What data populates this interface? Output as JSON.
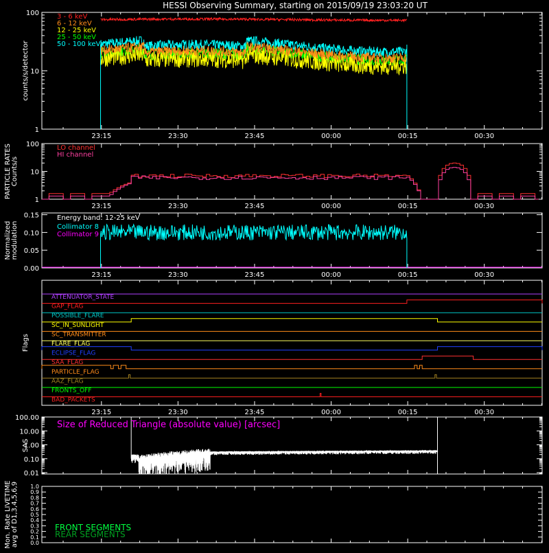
{
  "title": "HESSI Observing Summary, starting on 2015/09/19 23:03:20 UT",
  "time_axis": {
    "ticks": [
      "23:15",
      "23:30",
      "23:45",
      "00:00",
      "00:15",
      "00:30"
    ],
    "minor_ticks_per_major": 3,
    "unit": "minutes after 23:03:20 UT",
    "range": [
      0,
      98
    ],
    "tick_values": [
      11.67,
      26.67,
      41.67,
      56.67,
      71.67,
      86.67
    ]
  },
  "chart_data": [
    {
      "id": "count-rates",
      "type": "line",
      "ylabel": "counts/s/detector",
      "yscale": "log",
      "ylim": [
        1,
        100
      ],
      "yticks": [
        "1",
        "10",
        "100"
      ],
      "ytick_values": [
        1,
        10,
        100
      ],
      "legend_position": "top-left",
      "x_start": 11.5,
      "x_end": 71.5,
      "series": [
        {
          "name": "3 - 6 keV",
          "color": "#ff2020",
          "level": 75,
          "jitter": 0.05
        },
        {
          "name": "6 - 12 keV",
          "color": "#ff8c1a",
          "level": 22,
          "jitter": 0.2
        },
        {
          "name": "12 - 25 keV",
          "color": "#ffff00",
          "level": 16,
          "jitter": 0.35
        },
        {
          "name": "25 - 50 keV",
          "color": "#00ff00",
          "level": 20,
          "jitter": 0.22
        },
        {
          "name": "50 - 100 keV",
          "color": "#00ffff",
          "level": 28,
          "jitter": 0.2
        }
      ]
    },
    {
      "id": "particle-rates",
      "type": "line",
      "ylabel": "PARTICLE RATES",
      "ylabel2": "Counts/s",
      "yscale": "log",
      "ylim": [
        1,
        100
      ],
      "yticks": [
        "1",
        "10",
        "100"
      ],
      "ytick_values": [
        1,
        10,
        100
      ],
      "legend_position": "top-left",
      "series": [
        {
          "name": "LO channel",
          "color": "#ff3030",
          "lo_level": 1.6,
          "plateau": 7,
          "peak": 20
        },
        {
          "name": "HI channel",
          "color": "#ff40a0",
          "lo_level": 1.3,
          "plateau": 6,
          "peak": 14
        }
      ]
    },
    {
      "id": "modulation",
      "type": "line",
      "ylabel": "Normalized",
      "ylabel2": "modulation",
      "ylim": [
        0,
        0.155
      ],
      "yticks": [
        "0.00",
        "0.05",
        "0.10",
        "0.15"
      ],
      "ytick_values": [
        0,
        0.05,
        0.1,
        0.15
      ],
      "legend_position": "top-left",
      "energy_band": "Energy band: 12-25 keV",
      "x_start": 11.5,
      "x_end": 71.5,
      "series": [
        {
          "name": "Collimator 8",
          "color": "#00ffff",
          "level": 0.1
        },
        {
          "name": "Collimator 9",
          "color": "#ff00ff",
          "level": 0.0
        }
      ]
    },
    {
      "id": "flags",
      "type": "line",
      "ylabel": "Flags",
      "flags": [
        {
          "name": "ATTENUATOR_STATE",
          "color": "#b040ff",
          "events": []
        },
        {
          "name": "GAP_FLAG",
          "color": "#ff2020",
          "events": [
            [
              71.5,
              98
            ]
          ]
        },
        {
          "name": "POSSIBLE_FLARE",
          "color": "#00c8c8",
          "events": []
        },
        {
          "name": "SC_IN_SUNLIGHT",
          "color": "#ffff00",
          "events": [
            [
              17.5,
              77.5
            ]
          ]
        },
        {
          "name": "SC_TRANSMITTER",
          "color": "#ff8c1a",
          "events": []
        },
        {
          "name": "FLARE_FLAG",
          "color": "#ffff60",
          "events": []
        },
        {
          "name": "ECLIPSE_FLAG",
          "color": "#2040ff",
          "events": [
            [
              0,
              17.5
            ],
            [
              77.5,
              98
            ]
          ]
        },
        {
          "name": "SAA_FLAG",
          "color": "#ff3030",
          "events": [
            [
              74.5,
              84.5
            ]
          ]
        },
        {
          "name": "PARTICLE_FLAG",
          "color": "#ff8c1a",
          "events": [
            [
              0,
              13.5
            ],
            [
              14,
              15
            ],
            [
              15.5,
              16.5
            ],
            [
              73,
              73.5
            ],
            [
              74,
              74.5
            ]
          ]
        },
        {
          "name": "AAZ_FLAG",
          "color": "#a08020",
          "events": [
            [
              17,
              17.3
            ],
            [
              77,
              77.3
            ]
          ]
        },
        {
          "name": "FRONTS_OFF",
          "color": "#00ff00",
          "events": []
        },
        {
          "name": "BAD_PACKETS",
          "color": "#ff2020",
          "events": [
            [
              54.5,
              54.7
            ]
          ]
        }
      ]
    },
    {
      "id": "sas",
      "type": "line",
      "ylabel": "SAS",
      "yscale": "log",
      "ylim": [
        0.008,
        100
      ],
      "yticks": [
        "0.01",
        "0.10",
        "1.00",
        "10.00",
        "100.00"
      ],
      "ytick_values": [
        0.01,
        0.1,
        1,
        10,
        100
      ],
      "annotation": "Size of Reduced Triangle (absolute value) [arcsec]",
      "annotation_color": "#ff00ff",
      "series": [
        {
          "name": "",
          "color": "#ffffff",
          "x_start": 17.5,
          "x_end": 77.5
        }
      ]
    },
    {
      "id": "livetime",
      "type": "line",
      "ylabel": "Mon. Rate LIVETIME",
      "ylabel2": "avg of D1,3,4,5,6,9",
      "ylim": [
        0,
        1.0
      ],
      "yticks": [
        "0.0",
        "0.1",
        "0.2",
        "0.3",
        "0.4",
        "0.5",
        "0.6",
        "0.7",
        "0.8",
        "0.9",
        "1.0"
      ],
      "ytick_values": [
        0,
        0.1,
        0.2,
        0.3,
        0.4,
        0.5,
        0.6,
        0.7,
        0.8,
        0.9,
        1.0
      ],
      "legend_position": "bottom-left",
      "series": [
        {
          "name": "FRONT SEGMENTS",
          "color": "#00ff40"
        },
        {
          "name": "REAR SEGMENTS",
          "color": "#00a020"
        }
      ]
    }
  ]
}
